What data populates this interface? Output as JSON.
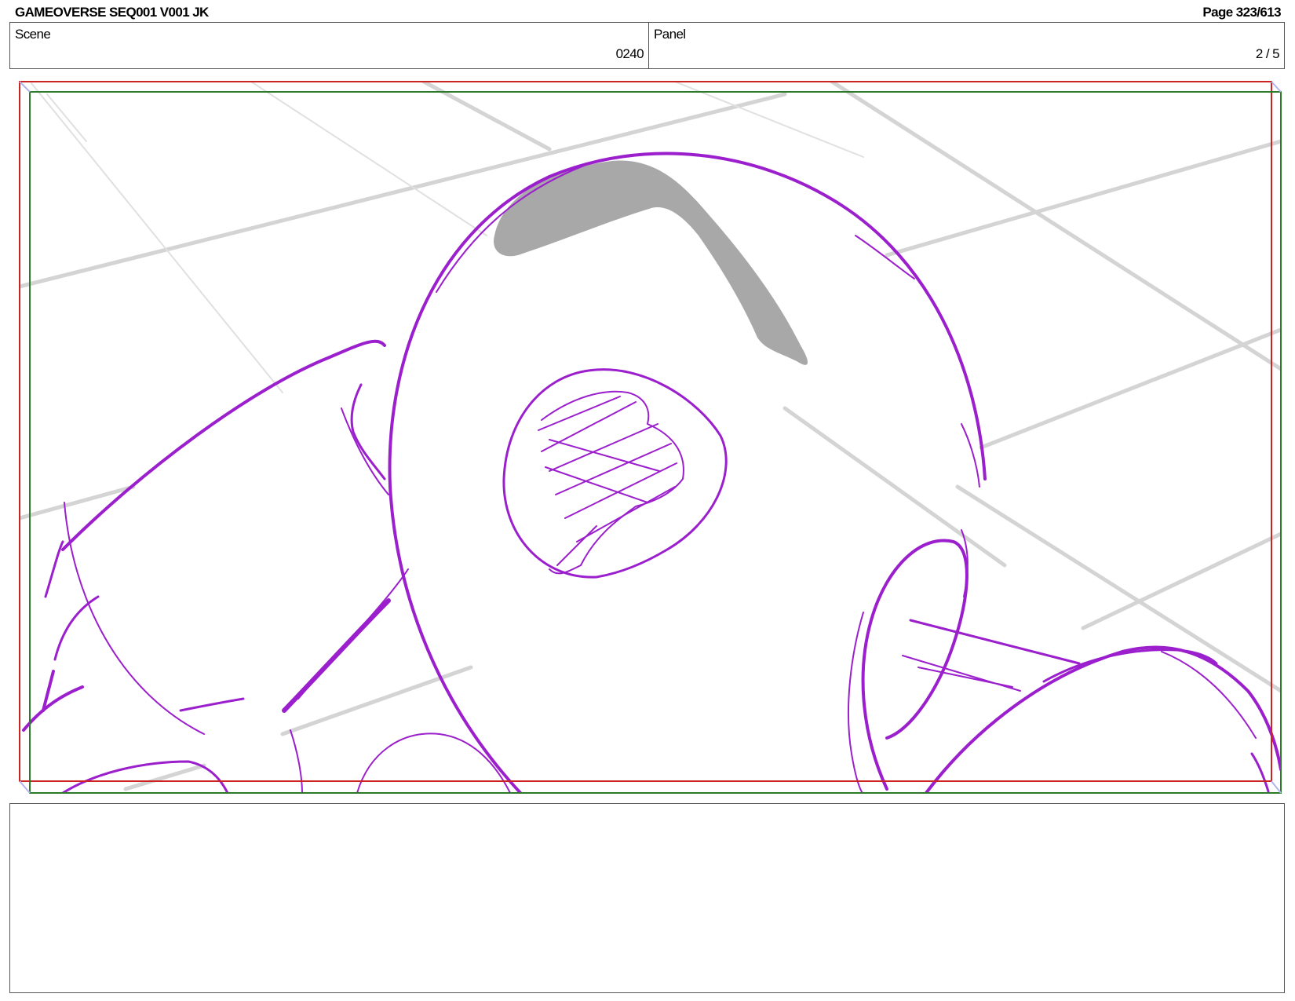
{
  "header": {
    "title": "GAMEOVERSE SEQ001 V001 JK",
    "page": "Page 323/613"
  },
  "scene": {
    "label": "Scene",
    "value": "0240"
  },
  "panel": {
    "label": "Panel",
    "value": "2 / 5"
  },
  "colors": {
    "sketch": "#9b1fcc",
    "safe_frame": "#cc2222",
    "camera_frame": "#2a7a2a",
    "grid": "#d4d4d4",
    "shadow": "#a8a8a8"
  },
  "notes": {
    "text": ""
  }
}
